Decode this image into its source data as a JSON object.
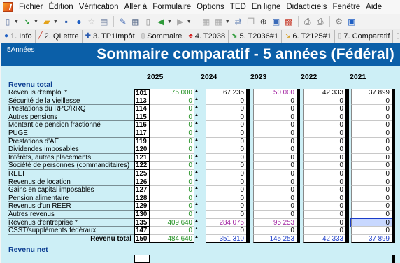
{
  "menu": [
    "Fichier",
    "Édition",
    "Vérification",
    "Aller à",
    "Formulaire",
    "Options",
    "TED",
    "En ligne",
    "Didacticiels",
    "Fenêtre",
    "Aide"
  ],
  "toolbar_icons": [
    "new-icon",
    "open-icon",
    "save-icon",
    "info-icon",
    "star-icon",
    "search-doc-icon",
    "edit-icon",
    "calculator-icon",
    "clipboard-icon",
    "back-arrow-icon",
    "forward-arrow-icon",
    "grid-icon",
    "grid-icon-2",
    "transfer-icon",
    "copy-icon",
    "zoom-icon",
    "table-icon",
    "chart-icon",
    "print-icon",
    "print-preview-icon",
    "settings-icon",
    "help-icon"
  ],
  "tabs": [
    {
      "icon": "info-icon",
      "label": "1. Info"
    },
    {
      "icon": "pencil-icon",
      "label": "2. QLettre"
    },
    {
      "icon": "cross-icon",
      "label": "3. TP1Impôt"
    },
    {
      "icon": "form-icon",
      "label": "Sommaire"
    },
    {
      "icon": "maple-leaf-icon",
      "label": "4. T2038"
    },
    {
      "icon": "tag-icon",
      "label": "5. T2036#1"
    },
    {
      "icon": "tag-icon",
      "label": "6. T2125#1"
    },
    {
      "icon": "form-icon",
      "label": "7. Comparatif"
    },
    {
      "icon": "form-icon",
      "label": "8"
    }
  ],
  "form": {
    "code": "5Années",
    "title": "Sommaire comparatif - 5 années (Fédéral)",
    "years": [
      "2025",
      "2024",
      "2023",
      "2022",
      "2021"
    ],
    "section1": "Revenu total",
    "section2": "Revenu net",
    "total_label": "Revenu total",
    "total_line": "150",
    "totals": [
      "484 640",
      "351 310",
      "145 253",
      "42 333",
      "37 899"
    ],
    "rows": [
      {
        "label": "Revenus d'emploi *",
        "line": "101",
        "values": [
          "75 000",
          "67 235",
          "50 000",
          "42 333",
          "37 899"
        ]
      },
      {
        "label": "Sécurité de la vieillesse",
        "line": "113",
        "values": [
          "0",
          "0",
          "0",
          "0",
          "0"
        ]
      },
      {
        "label": "Prestations du RPC/RRQ",
        "line": "114",
        "values": [
          "0",
          "0",
          "0",
          "0",
          "0"
        ]
      },
      {
        "label": "Autres pensions",
        "line": "115",
        "values": [
          "0",
          "0",
          "0",
          "0",
          "0"
        ]
      },
      {
        "label": "Montant de pension fractionné",
        "line": "116",
        "values": [
          "0",
          "0",
          "0",
          "0",
          "0"
        ]
      },
      {
        "label": "PUGE",
        "line": "117",
        "values": [
          "0",
          "0",
          "0",
          "0",
          "0"
        ]
      },
      {
        "label": "Prestations d'AE",
        "line": "119",
        "values": [
          "0",
          "0",
          "0",
          "0",
          "0"
        ]
      },
      {
        "label": "Dividendes imposables",
        "line": "120",
        "values": [
          "0",
          "0",
          "0",
          "0",
          "0"
        ]
      },
      {
        "label": "Intérêts, autres placements",
        "line": "121",
        "values": [
          "0",
          "0",
          "0",
          "0",
          "0"
        ]
      },
      {
        "label": "Société de personnes (commanditaires)",
        "line": "122",
        "values": [
          "0",
          "0",
          "0",
          "0",
          "0"
        ]
      },
      {
        "label": "REEI",
        "line": "125",
        "values": [
          "0",
          "0",
          "0",
          "0",
          "0"
        ]
      },
      {
        "label": "Revenus de location",
        "line": "126",
        "values": [
          "0",
          "0",
          "0",
          "0",
          "0"
        ]
      },
      {
        "label": "Gains en capital imposables",
        "line": "127",
        "values": [
          "0",
          "0",
          "0",
          "0",
          "0"
        ]
      },
      {
        "label": "Pension alimentaire",
        "line": "128",
        "values": [
          "0",
          "0",
          "0",
          "0",
          "0"
        ]
      },
      {
        "label": "Revenus d'un REER",
        "line": "129",
        "values": [
          "0",
          "0",
          "0",
          "0",
          "0"
        ]
      },
      {
        "label": "Autres revenus",
        "line": "130",
        "values": [
          "0",
          "0",
          "0",
          "0",
          "0"
        ]
      },
      {
        "label": "Revenus d'entreprise *",
        "line": "135",
        "values": [
          "409 640",
          "284 075",
          "95 253",
          "0",
          "0"
        ]
      },
      {
        "label": "CSST/suppléments fédéraux",
        "line": "147",
        "values": [
          "0",
          "0",
          "0",
          "0",
          "0"
        ]
      }
    ]
  }
}
